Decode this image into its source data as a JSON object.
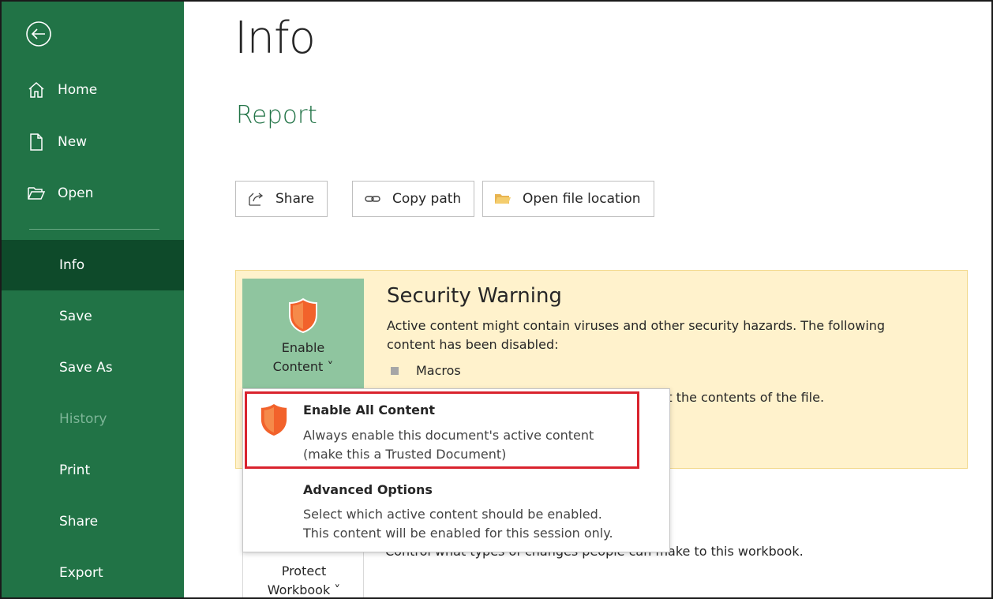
{
  "sidebar": {
    "items": [
      {
        "label": "Home"
      },
      {
        "label": "New"
      },
      {
        "label": "Open"
      },
      {
        "label": "Info"
      },
      {
        "label": "Save"
      },
      {
        "label": "Save As"
      },
      {
        "label": "History"
      },
      {
        "label": "Print"
      },
      {
        "label": "Share"
      },
      {
        "label": "Export"
      }
    ],
    "active": "Info",
    "disabled": "History"
  },
  "main": {
    "page_title": "Info",
    "doc_title": "Report",
    "actions": {
      "share": "Share",
      "copy_path": "Copy path",
      "open_location": "Open file location"
    }
  },
  "security": {
    "enable_line1": "Enable",
    "enable_line2": "Content ˅",
    "title": "Security Warning",
    "desc_line1": "Active content might contain viruses and other security hazards. The following",
    "desc_line2": "content has been disabled:",
    "macros": "Macros",
    "trust_text": "st the contents of the file."
  },
  "dropdown": {
    "enable_all_title": "Enable All Content",
    "enable_all_desc1": "Always enable this document's active content",
    "enable_all_desc2": "(make this a Trusted Document)",
    "advanced_title": "Advanced Options",
    "advanced_desc1": "Select which active content should be enabled.",
    "advanced_desc2": "This content will be enabled for this session only."
  },
  "protect": {
    "line1": "Protect",
    "line2": "Workbook ˅",
    "desc": "Control what types of changes people can make to this workbook."
  },
  "colors": {
    "sidebar": "#217346",
    "sidebar_active": "#0e4a2a",
    "warning_bg": "#fff2cc",
    "enable_tile": "#8fc59f",
    "shield": "#f2622b",
    "highlight": "#d9232d"
  }
}
